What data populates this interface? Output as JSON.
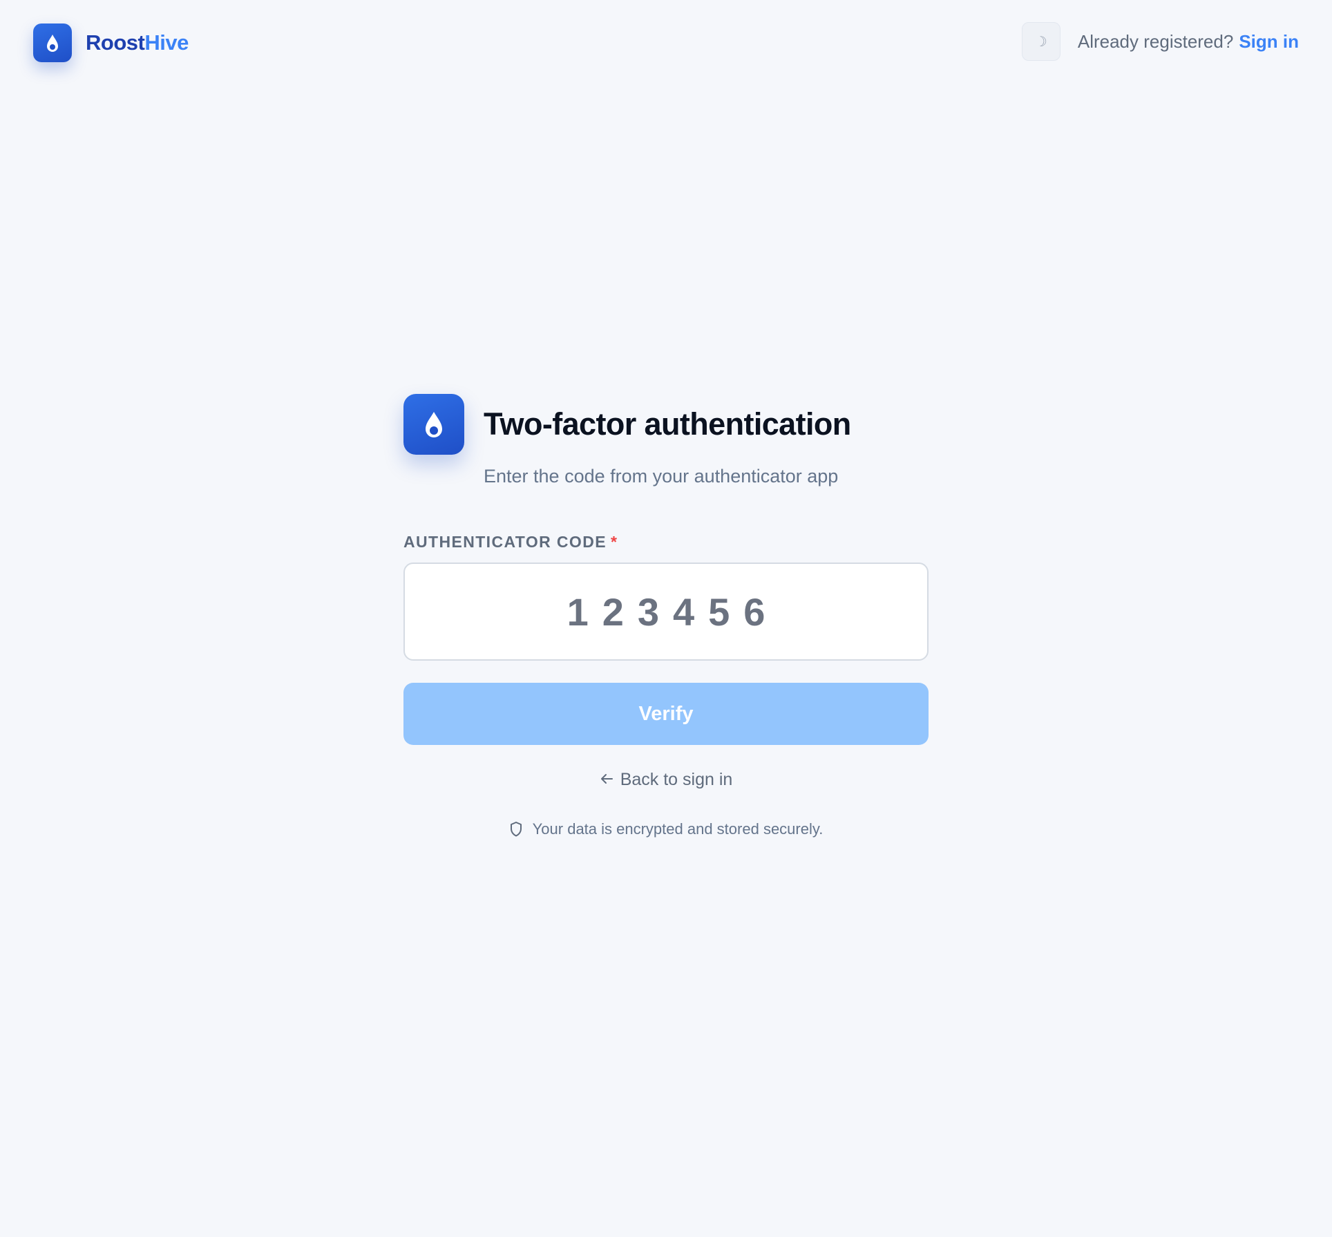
{
  "header": {
    "brand_part1": "Roost",
    "brand_part2": "Hive",
    "theme_toggle_icon": "moon-icon",
    "already_text": "Already registered?",
    "signin_label": "Sign in"
  },
  "card": {
    "title": "Two-factor authentication",
    "subtitle": "Enter the code from your authenticator app",
    "field_label": "AUTHENTICATOR CODE",
    "required_marker": "*",
    "code_value": "123456",
    "verify_label": "Verify",
    "back_label": "Back to sign in",
    "secure_note": "Your data is encrypted and stored securely."
  },
  "colors": {
    "brand_primary": "#1f4fc7",
    "brand_accent": "#3b82f6",
    "verify_disabled": "#93c5fd",
    "required": "#ef4444",
    "background": "#f5f7fb"
  },
  "icons": {
    "logo": "droplet-logo-icon",
    "back": "arrow-left-icon",
    "secure": "shield-icon"
  }
}
